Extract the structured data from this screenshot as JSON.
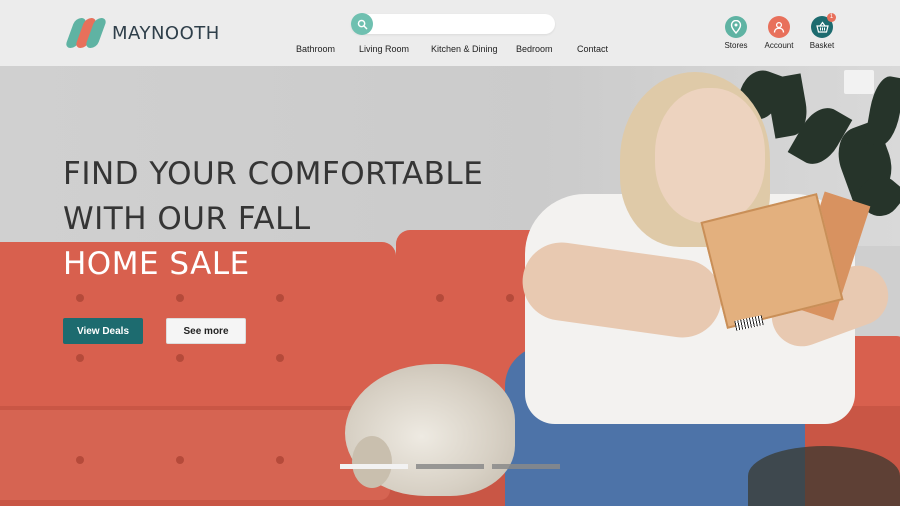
{
  "brand": {
    "name": "MAYNOOTH"
  },
  "search": {
    "placeholder": "",
    "value": ""
  },
  "nav": {
    "items": [
      {
        "label": "Bathroom"
      },
      {
        "label": "Living Room"
      },
      {
        "label": "Kitchen & Dining"
      },
      {
        "label": "Bedroom"
      },
      {
        "label": "Contact"
      }
    ]
  },
  "utility": {
    "stores_label": "Stores",
    "account_label": "Account",
    "basket_label": "Basket",
    "basket_count": "1"
  },
  "hero": {
    "headline_line1": "FIND YOUR COMFORTABLE",
    "headline_line2": "WITH OUR FALL",
    "headline_line3": "HOME SALE",
    "primary_button": "View Deals",
    "secondary_button": "See more",
    "slides_total": 3,
    "slides_active": 1
  },
  "colors": {
    "accent_teal": "#6fc0b0",
    "accent_coral": "#e8705b",
    "button_primary": "#1d6b6f",
    "dark_teal": "#1d6b6f"
  },
  "icons": {
    "search": "search-icon",
    "stores": "location-pin-icon",
    "account": "user-icon",
    "basket": "basket-icon"
  }
}
